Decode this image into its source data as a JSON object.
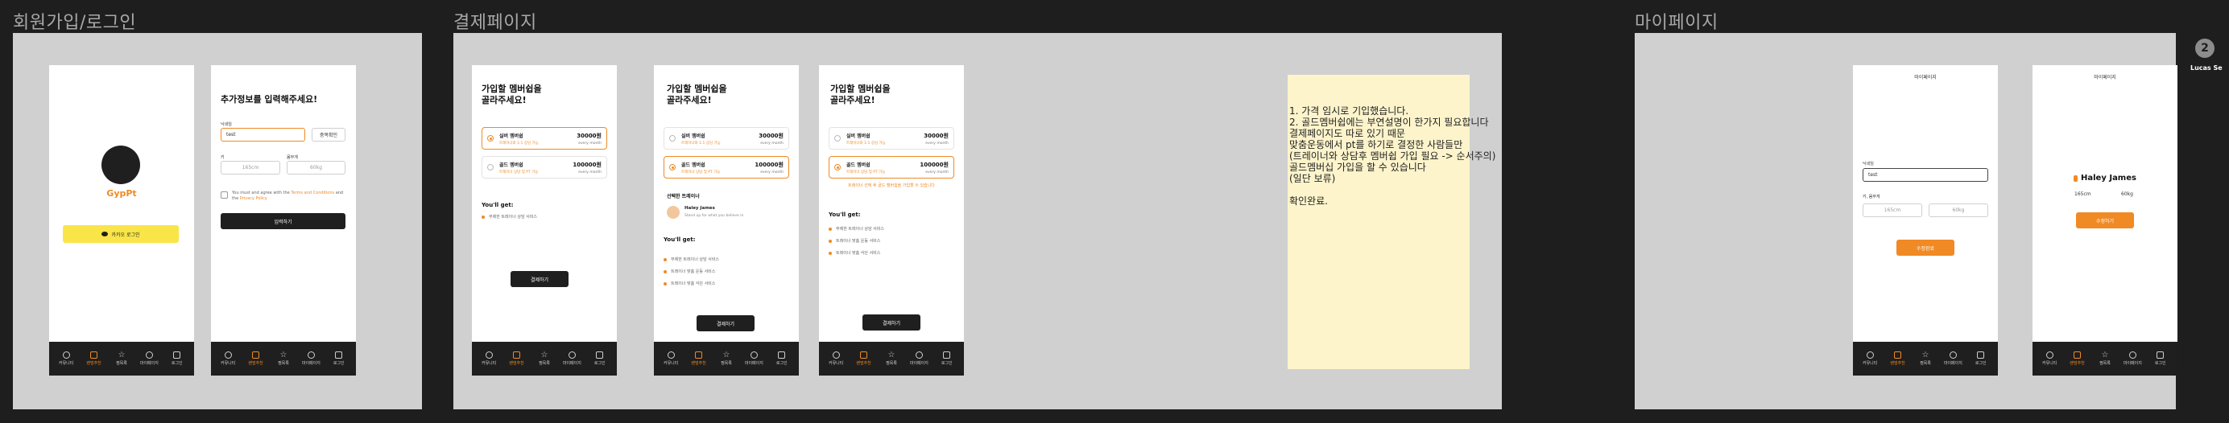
{
  "sections": {
    "signup": "회원가입/로그인",
    "payment": "결제페이지",
    "mypage": "마이페이지"
  },
  "tabs": [
    "커뮤니티",
    "랜덤추천",
    "찜목록",
    "마이페이지",
    "로그인"
  ],
  "login": {
    "brand": "GypPt",
    "kakao_button": "카카오 로그인"
  },
  "signup_form": {
    "title": "추가정보를 입력해주세요!",
    "nickname_label": "닉네임",
    "nickname_value": "test",
    "check_button": "중복확인",
    "height_label": "키",
    "weight_label": "몸무게",
    "height_placeholder": "165cm",
    "weight_placeholder": "60kg",
    "agree_prefix": "You must and agree with the ",
    "agree_terms": "Terms and Conditions",
    "agree_mid": " and the ",
    "agree_policy": "Privacy Policy",
    "submit_button": "입력하기"
  },
  "payment": {
    "title_line1": "가입할 멤버쉽을",
    "title_line2": "골라주세요!",
    "plans": [
      {
        "name": "실버 멤버쉽",
        "desc": "트레이너와 1:1 상담 가능",
        "price": "30000원",
        "per": "every month"
      },
      {
        "name": "골드 멤버쉽",
        "desc": "트레이너 상담 및 PT 가능",
        "price": "100000원",
        "per": "every month"
      }
    ],
    "trainer_header": "선택한 트레이너",
    "trainer_name": "Haley James",
    "trainer_desc": "Stand up for what you believe in",
    "gets_title": "You'll get:",
    "silver_gets": [
      "무제한 트레이너 상담 서비스"
    ],
    "gold_gets": [
      "무제한 트레이너 상담 서비스",
      "트레이너 맞춤 운동 서비스",
      "트레이너 맞춤 식단 서비스"
    ],
    "warning": "트레이너 선택 후 골드 멤버쉽을 가입할 수 있습니다",
    "pay_button": "결제하기"
  },
  "note": {
    "lines": [
      "1. 가격 임시로 기입했습니다.",
      "2. 골드멤버쉽에는 부연설명이 한가지 필요합니다",
      "결제페이지도 따로 있기 때문",
      "맞춤운동에서 pt를 하기로 결정한 사람들만",
      "(트레이너와 상담후 멤버쉽 가입 필요 -> 순서주의)",
      "골드멤버십 가입을 할 수 있습니다",
      "(일단 보류)",
      "",
      "확인완료."
    ]
  },
  "mypage": {
    "header": "마이페이지",
    "nickname_label": "닉네임",
    "nickname_value": "test",
    "hw_label": "키, 몸무게",
    "height_placeholder": "165cm",
    "weight_placeholder": "60kg",
    "edit_button": "수정완료",
    "profile_name": "Haley James",
    "profile_height": "165cm",
    "profile_weight": "60kg",
    "profile_button": "수정하기"
  },
  "user": {
    "initial": "2",
    "name": "Lucas Se"
  }
}
